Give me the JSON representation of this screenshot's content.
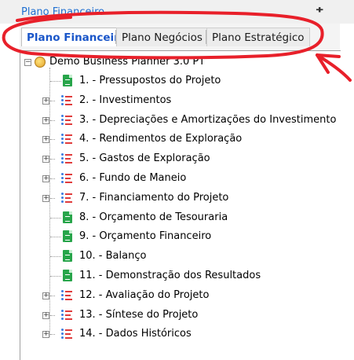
{
  "panel": {
    "title": "Plano Financeiro",
    "pin_glyph": "ᚐ"
  },
  "tabs": [
    {
      "label": "Plano Financeiro",
      "active": true
    },
    {
      "label": "Plano Negócios",
      "active": false
    },
    {
      "label": "Plano Estratégico",
      "active": false
    }
  ],
  "tree": {
    "root": {
      "label": "Demo Business Planner 3.0 PT",
      "icon": "globe-icon",
      "expanded": true
    },
    "items": [
      {
        "label": "1. - Pressupostos do Projeto",
        "icon": "spreadsheet-icon",
        "expandable": false
      },
      {
        "label": "2. - Investimentos",
        "icon": "list-icon",
        "expandable": true
      },
      {
        "label": "3. - Depreciações e Amortizações do Investimento",
        "icon": "list-icon",
        "expandable": true
      },
      {
        "label": "4. - Rendimentos de Exploração",
        "icon": "list-icon",
        "expandable": true
      },
      {
        "label": "5. - Gastos de Exploração",
        "icon": "list-icon",
        "expandable": true
      },
      {
        "label": "6. - Fundo de Maneio",
        "icon": "list-icon",
        "expandable": true
      },
      {
        "label": "7. - Financiamento do Projeto",
        "icon": "list-icon",
        "expandable": true
      },
      {
        "label": "8. - Orçamento de Tesouraria",
        "icon": "spreadsheet-icon",
        "expandable": false
      },
      {
        "label": "9. - Orçamento Financeiro",
        "icon": "spreadsheet-icon",
        "expandable": false
      },
      {
        "label": "10. - Balanço",
        "icon": "spreadsheet-icon",
        "expandable": false
      },
      {
        "label": "11. - Demonstração dos Resultados",
        "icon": "spreadsheet-icon",
        "expandable": false
      },
      {
        "label": "12. - Avaliação do Projeto",
        "icon": "list-icon",
        "expandable": true
      },
      {
        "label": "13. - Síntese do Projeto",
        "icon": "list-icon",
        "expandable": true
      },
      {
        "label": "14. - Dados Históricos",
        "icon": "list-icon",
        "expandable": true
      }
    ]
  },
  "colors": {
    "annotation": "#e8202a",
    "active_tab": "#1a56c9",
    "sheet_icon": "#27a54a"
  }
}
